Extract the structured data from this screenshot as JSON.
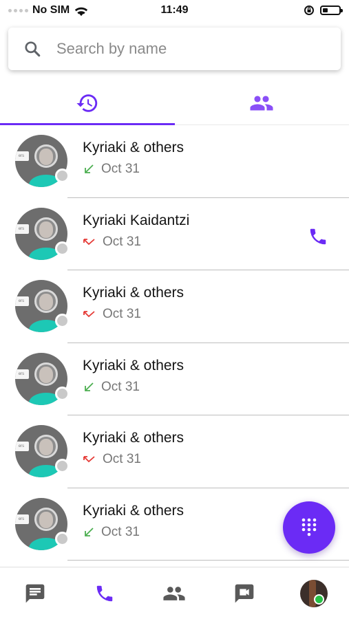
{
  "status_bar": {
    "carrier": "No SIM",
    "time": "11:49"
  },
  "search": {
    "placeholder": "Search by name",
    "value": ""
  },
  "tabs": [
    {
      "icon": "history-icon",
      "active": true
    },
    {
      "icon": "contacts-icon",
      "active": false
    }
  ],
  "calls": [
    {
      "name": "Kyriaki & others",
      "date": "Oct 31",
      "direction": "incoming"
    },
    {
      "name": "Kyriaki Kaidantzi",
      "date": "Oct 31",
      "direction": "missed",
      "has_call_button": true
    },
    {
      "name": "Kyriaki & others",
      "date": "Oct 31",
      "direction": "missed"
    },
    {
      "name": "Kyriaki & others",
      "date": "Oct 31",
      "direction": "incoming"
    },
    {
      "name": "Kyriaki & others",
      "date": "Oct 31",
      "direction": "missed"
    },
    {
      "name": "Kyriaki & others",
      "date": "Oct 31",
      "direction": "incoming"
    }
  ],
  "bottom_nav": [
    {
      "icon": "chat-icon",
      "active": false
    },
    {
      "icon": "phone-icon",
      "active": true
    },
    {
      "icon": "people-icon",
      "active": false
    },
    {
      "icon": "video-icon",
      "active": false
    },
    {
      "icon": "profile-avatar",
      "active": false
    }
  ],
  "colors": {
    "accent": "#6b2bf5",
    "incoming": "#4caf50",
    "missed": "#e53935",
    "online": "#27c146"
  }
}
